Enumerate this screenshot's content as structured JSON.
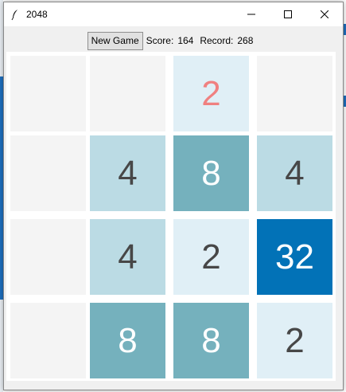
{
  "window": {
    "title": "2048",
    "icon": "feather-icon",
    "controls": [
      "minimize-icon",
      "maximize-icon",
      "close-icon"
    ]
  },
  "toolbar": {
    "new_game_label": "New Game",
    "score_label": "Score:",
    "score_value": "164",
    "record_label": "Record:",
    "record_value": "268"
  },
  "board": {
    "rows": [
      [
        "",
        "",
        "2",
        ""
      ],
      [
        "",
        "4",
        "8",
        "4"
      ],
      [
        "",
        "4",
        "2",
        "32"
      ],
      [
        "",
        "8",
        "8",
        "2"
      ]
    ],
    "new_tile": [
      0,
      2
    ]
  },
  "colors": {
    "empty": "#f4f4f4",
    "tile_2": "#e0eff6",
    "tile_4": "#bbdbe4",
    "tile_8": "#75b1bd",
    "tile_32": "#0272b7",
    "new_tile_text": "#f08080"
  }
}
